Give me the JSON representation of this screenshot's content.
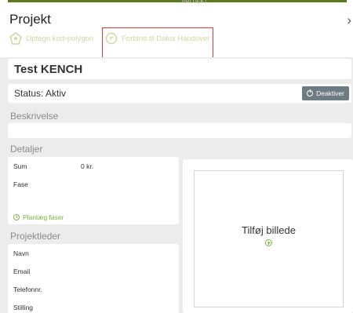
{
  "header": {
    "top_ghost_text": "PROJEKT",
    "title": "Projekt",
    "close_glyph": "›",
    "tools": [
      {
        "label": "Optegn kort-polygon",
        "icon": "map-polygon-icon"
      },
      {
        "label": "Forbind til Dalux Handover",
        "icon": "link-icon"
      }
    ]
  },
  "project": {
    "name": "Test KENCH",
    "status_text": "Status: Aktiv",
    "deactivate_label": "Deaktiver"
  },
  "sections": {
    "beskrivelse": "Beskrivelse",
    "detaljer": "Detaljer",
    "projektleder": "Projektleder"
  },
  "details": {
    "sum_label": "Sum",
    "sum_value": "0 kr.",
    "fase_label": "Fase",
    "plan_label": "Planlæg faser"
  },
  "project_leader": {
    "fields": [
      "Navn",
      "Email",
      "Telefonnr.",
      "Stilling"
    ]
  },
  "image": {
    "add_label": "Tilføj billede"
  },
  "colors": {
    "accent_green": "#7cb342",
    "header_line": "#5a7a1e",
    "highlight": "#e53935",
    "button_gray": "#6d7b82"
  }
}
